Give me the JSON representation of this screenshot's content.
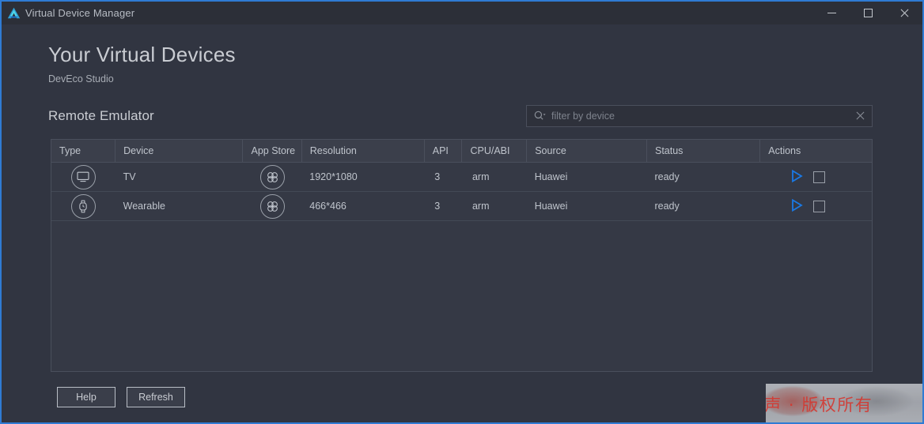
{
  "window": {
    "title": "Virtual Device Manager",
    "logo_icon": "deveco-logo-icon",
    "controls": {
      "minimize": "minimize-icon",
      "maximize": "maximize-icon",
      "close": "close-icon"
    }
  },
  "header": {
    "title": "Your Virtual Devices",
    "subtitle": "DevEco Studio"
  },
  "section": {
    "title": "Remote Emulator"
  },
  "search": {
    "icon": "search-icon",
    "value": "",
    "placeholder": "filter by device",
    "clear_icon": "clear-icon"
  },
  "table": {
    "columns": [
      "Type",
      "Device",
      "App Store",
      "Resolution",
      "API",
      "CPU/ABI",
      "Source",
      "Status",
      "Actions"
    ],
    "rows": [
      {
        "type_icon": "tv-icon",
        "device": "TV",
        "app_store_icon": "appgallery-icon",
        "resolution": "1920*1080",
        "api": "3",
        "cpu_abi": "arm",
        "source": "Huawei",
        "status": "ready",
        "actions": {
          "play_icon": "play-icon",
          "stop_icon": "stop-icon"
        }
      },
      {
        "type_icon": "watch-icon",
        "device": "Wearable",
        "app_store_icon": "appgallery-icon",
        "resolution": "466*466",
        "api": "3",
        "cpu_abi": "arm",
        "source": "Huawei",
        "status": "ready",
        "actions": {
          "play_icon": "play-icon",
          "stop_icon": "stop-icon"
        }
      }
    ]
  },
  "footer": {
    "help_label": "Help",
    "refresh_label": "Refresh"
  },
  "watermark": {
    "text": "微笑涛声 · 版权所有"
  },
  "colors": {
    "window_border": "#2f7bd4",
    "titlebar_bg": "#2c2f38",
    "page_bg": "#313541",
    "table_bg": "#353945",
    "table_header_bg": "#3b3f4b",
    "border": "#4a4f5c",
    "text_primary": "#c9ccd2",
    "text_secondary": "#a7acb4",
    "accent_play": "#1a79e5",
    "watermark_red": "#d6342c"
  }
}
